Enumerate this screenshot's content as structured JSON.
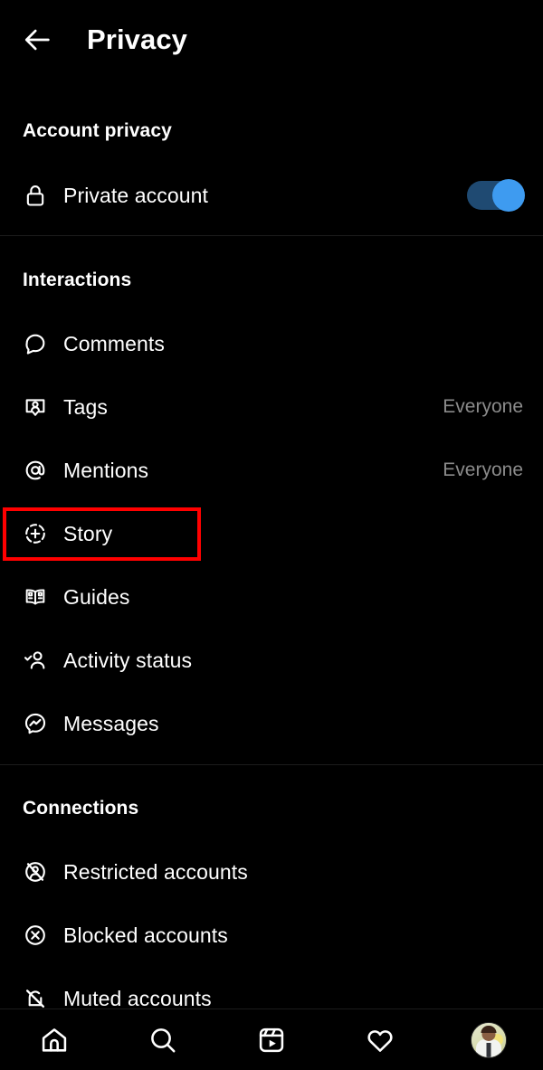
{
  "header": {
    "back_icon": "arrow-left-icon",
    "title": "Privacy"
  },
  "sections": [
    {
      "id": "account-privacy",
      "title": "Account privacy",
      "rows": [
        {
          "id": "private-account",
          "icon": "lock-icon",
          "label": "Private account",
          "control": "toggle",
          "toggle_on": true
        }
      ]
    },
    {
      "id": "interactions",
      "title": "Interactions",
      "rows": [
        {
          "id": "comments",
          "icon": "comment-bubble-icon",
          "label": "Comments",
          "value": ""
        },
        {
          "id": "tags",
          "icon": "tag-person-icon",
          "label": "Tags",
          "value": "Everyone"
        },
        {
          "id": "mentions",
          "icon": "at-mention-icon",
          "label": "Mentions",
          "value": "Everyone"
        },
        {
          "id": "story",
          "icon": "story-plus-icon",
          "label": "Story",
          "value": "",
          "highlighted": true
        },
        {
          "id": "guides",
          "icon": "open-book-icon",
          "label": "Guides",
          "value": ""
        },
        {
          "id": "activity-status",
          "icon": "person-check-icon",
          "label": "Activity status",
          "value": ""
        },
        {
          "id": "messages",
          "icon": "messenger-icon",
          "label": "Messages",
          "value": ""
        }
      ]
    },
    {
      "id": "connections",
      "title": "Connections",
      "rows": [
        {
          "id": "restricted-accounts",
          "icon": "person-slash-circle-icon",
          "label": "Restricted accounts",
          "value": ""
        },
        {
          "id": "blocked-accounts",
          "icon": "x-circle-icon",
          "label": "Blocked accounts",
          "value": ""
        },
        {
          "id": "muted-accounts",
          "icon": "mute-slash-icon",
          "label": "Muted accounts",
          "value": ""
        }
      ]
    }
  ],
  "bottom_nav": [
    {
      "id": "home",
      "icon": "home-icon"
    },
    {
      "id": "search",
      "icon": "search-icon"
    },
    {
      "id": "reels",
      "icon": "reels-icon"
    },
    {
      "id": "activity",
      "icon": "heart-icon"
    },
    {
      "id": "profile",
      "icon": "profile-avatar"
    }
  ],
  "colors": {
    "background": "#000000",
    "text_primary": "#ffffff",
    "text_secondary": "#8b8b8b",
    "toggle_on_track": "#1f4a72",
    "toggle_on_knob": "#3e9bf0",
    "highlight": "#ff0000",
    "divider": "#1c1c1c"
  }
}
